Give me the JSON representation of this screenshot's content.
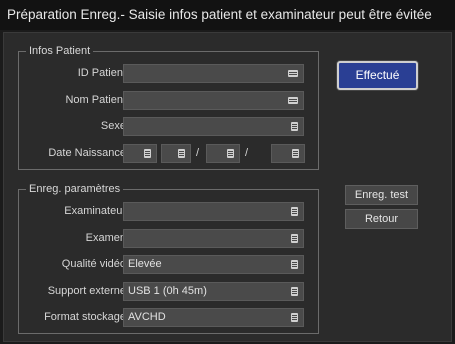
{
  "window": {
    "title": "Préparation Enreg.- Saisie infos patient et examinateur peut être évitée"
  },
  "patient": {
    "legend": "Infos Patient",
    "id_label": "ID Patient",
    "id_value": "",
    "name_label": "Nom Patient",
    "name_value": "",
    "sex_label": "Sexe",
    "sex_value": "",
    "dob_label": "Date Naissance",
    "dob_separator": "/"
  },
  "params": {
    "legend": "Enreg. paramètres",
    "examiner_label": "Examinateur",
    "examiner_value": "",
    "exam_label": "Examen",
    "exam_value": "",
    "quality_label": "Qualité vidéo",
    "quality_value": "Elevée",
    "media_label": "Support externe",
    "media_value": "USB 1 (0h 45m)",
    "format_label": "Format stockage",
    "format_value": "AVCHD"
  },
  "buttons": {
    "done": "Effectué",
    "test": "Enreg. test",
    "back": "Retour"
  },
  "icons": {
    "text_entry": "keyboard-icon",
    "selection": "list-icon"
  },
  "colors": {
    "primary_button": "#2a3f94",
    "background": "#2b2b2b",
    "field": "#4a4a4a"
  }
}
